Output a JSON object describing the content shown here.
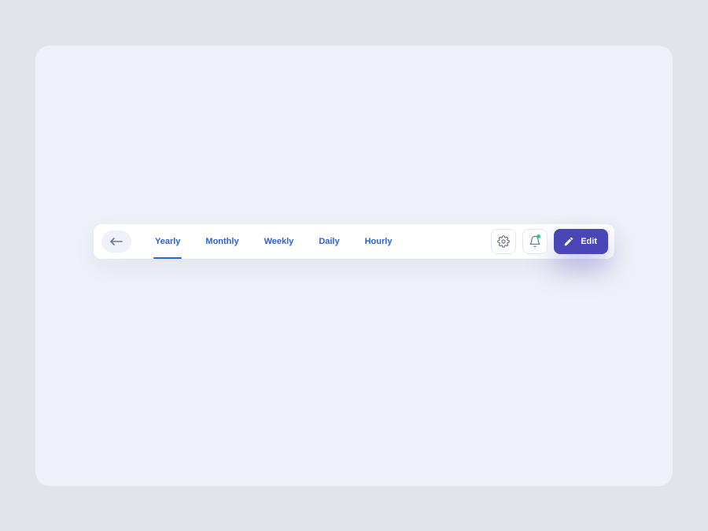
{
  "tabs": {
    "items": [
      {
        "label": "Yearly"
      },
      {
        "label": "Monthly"
      },
      {
        "label": "Weekly"
      },
      {
        "label": "Daily"
      },
      {
        "label": "Hourly"
      }
    ],
    "active_index": 0
  },
  "actions": {
    "edit_label": "Edit"
  },
  "colors": {
    "accent": "#4b46b7",
    "tab_text": "#2b62d9",
    "panel_bg": "#eef1f8",
    "page_bg": "#e2e4e9",
    "notification_dot": "#35c28f"
  }
}
